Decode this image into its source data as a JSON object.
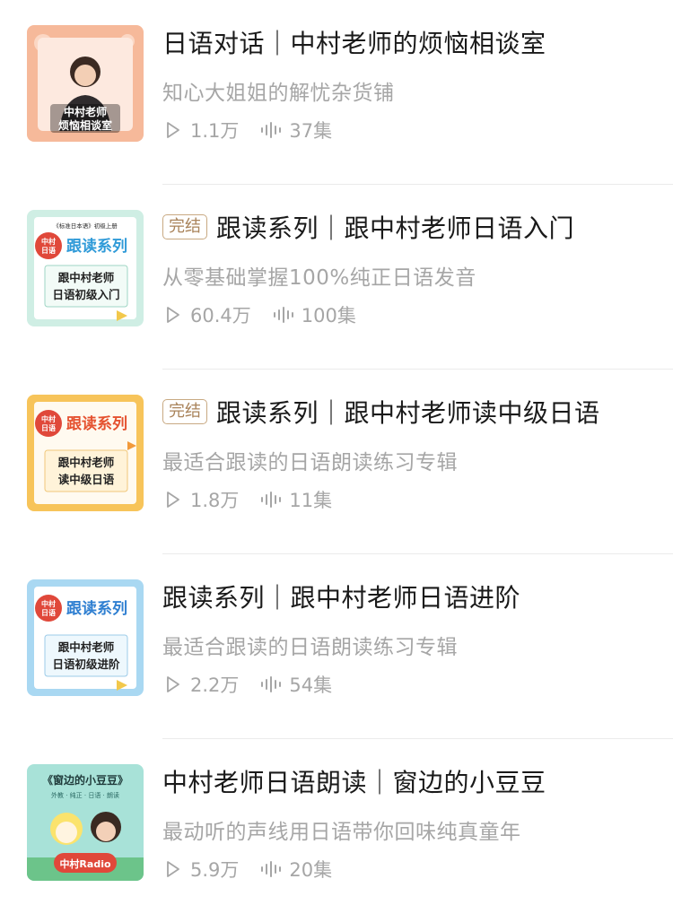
{
  "album_list": [
    {
      "title": "日语对话｜中村老师的烦恼相谈室",
      "subtitle": "知心大姐姐的解忧杂货铺",
      "plays": "1.1万",
      "episodes": "37集",
      "badge": "",
      "cover": {
        "caption_line1": "中村老师",
        "caption_line2": "烦恼相谈室",
        "bg": "#f6b99a"
      }
    },
    {
      "title": "跟读系列｜跟中村老师日语入门",
      "subtitle": "从零基础掌握100%纯正日语发音",
      "plays": "60.4万",
      "episodes": "100集",
      "badge": "完结",
      "cover": {
        "top_note": "《标准日本语》初级上册",
        "logo_line1": "中村",
        "logo_line2": "日语",
        "series": "跟读系列",
        "line1": "跟中村老师",
        "line2": "日语初级入门",
        "bg": "#cfeee4"
      }
    },
    {
      "title": "跟读系列｜跟中村老师读中级日语",
      "subtitle": "最适合跟读的日语朗读练习专辑",
      "plays": "1.8万",
      "episodes": "11集",
      "badge": "完结",
      "cover": {
        "logo_line1": "中村",
        "logo_line2": "日语",
        "series": "跟读系列",
        "line1": "跟中村老师",
        "line2": "读中级日语",
        "bg": "#f7c45a"
      }
    },
    {
      "title": "跟读系列｜跟中村老师日语进阶",
      "subtitle": "最适合跟读的日语朗读练习专辑",
      "plays": "2.2万",
      "episodes": "54集",
      "badge": "",
      "cover": {
        "logo_line1": "中村",
        "logo_line2": "日语",
        "series": "跟读系列",
        "line1": "跟中村老师",
        "line2": "日语初级进阶",
        "bg": "#a9d8f2"
      }
    },
    {
      "title": "中村老师日语朗读｜窗边的小豆豆",
      "subtitle": "最动听的声线用日语带你回味纯真童年",
      "plays": "5.9万",
      "episodes": "20集",
      "badge": "",
      "cover": {
        "book_title": "《窗边的小豆豆》",
        "tags": "外教 · 纯正 · 日语 · 朗读",
        "brand": "中村Radio",
        "bg": "#a8e2d8"
      }
    }
  ],
  "colors": {
    "badge": "#a9835a",
    "meta": "#a6a6a6",
    "divider": "#ebebeb"
  },
  "icons": {
    "play": "play-outline-icon",
    "episodes": "audio-wave-icon"
  }
}
